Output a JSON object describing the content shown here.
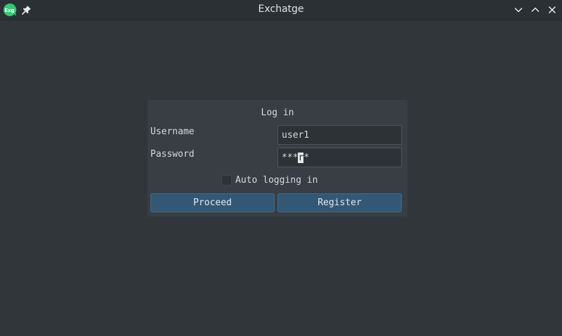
{
  "window": {
    "title": "Exchatge",
    "app_icon_text": "Exg",
    "app_icon_color": "#2ecc71",
    "icons": [
      "app-logo-icon",
      "pin-icon",
      "minimize-icon",
      "maximize-icon",
      "close-icon"
    ]
  },
  "login": {
    "title": "Log in",
    "username_label": "Username",
    "password_label": "Password",
    "username_value": "user1",
    "password_before_caret": "***",
    "password_caret_char": "r",
    "password_after_caret": "*",
    "auto_login_label": "Auto logging in",
    "auto_login_checked": false,
    "proceed_label": "Proceed",
    "register_label": "Register"
  },
  "colors": {
    "background": "#30363a",
    "panel": "#383e43",
    "button": "#335875",
    "field": "#2d3236",
    "text": "#d6d9db"
  }
}
